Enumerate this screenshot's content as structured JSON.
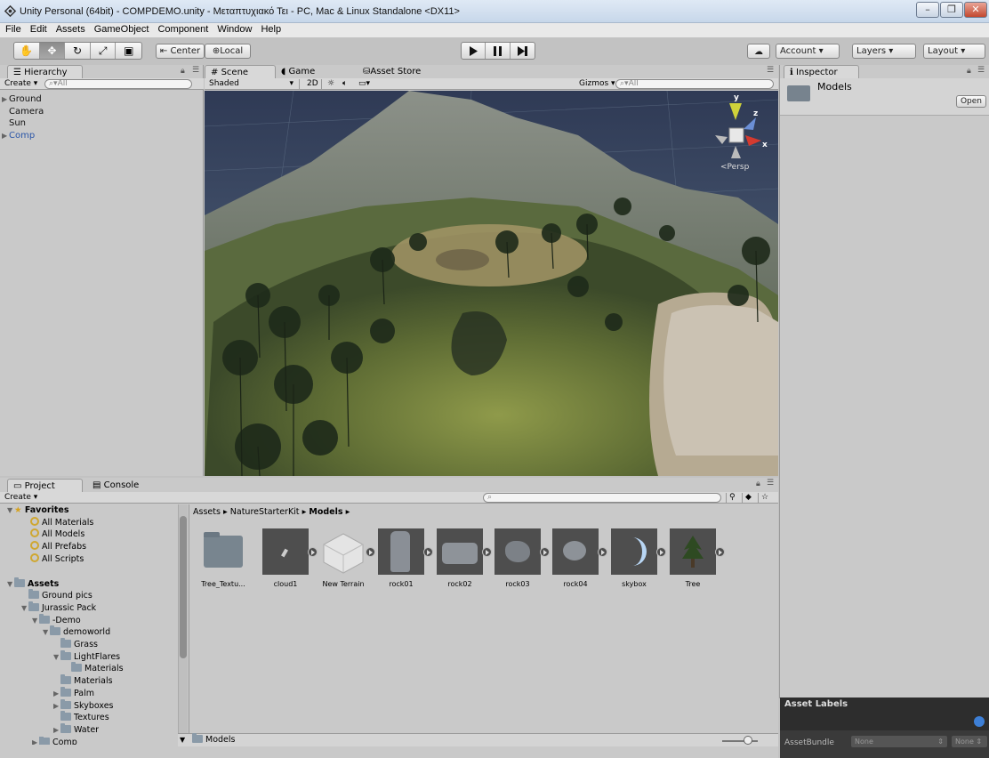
{
  "window": {
    "title": "Unity Personal (64bit) - COMPDEMO.unity - Μεταπτυχιακό Τει - PC, Mac & Linux Standalone <DX11>",
    "min_label": "–",
    "max_label": "❐",
    "close_label": "✕"
  },
  "menu": [
    "File",
    "Edit",
    "Assets",
    "GameObject",
    "Component",
    "Window",
    "Help"
  ],
  "toolbar": {
    "pivot_label": "Center",
    "space_label": "Local",
    "account_label": "Account",
    "layers_label": "Layers",
    "layout_label": "Layout"
  },
  "hierarchy": {
    "tab_label": "Hierarchy",
    "create_label": "Create",
    "search_placeholder": "All",
    "items": [
      "Ground",
      "Camera",
      "Sun",
      "Comp"
    ]
  },
  "scene": {
    "tabs": [
      "Scene",
      "Game",
      "Asset Store"
    ],
    "shading_label": "Shaded",
    "mode_2d_label": "2D",
    "gizmos_label": "Gizmos",
    "search_placeholder": "All",
    "gizmo_y": "y",
    "gizmo_z": "z",
    "gizmo_x": "x",
    "persp_label": "Persp"
  },
  "inspector": {
    "tab_label": "Inspector",
    "object_name": "Models",
    "open_label": "Open",
    "asset_labels_title": "Asset Labels",
    "assetbundle_label": "AssetBundle",
    "assetbundle_value": "None",
    "assetbundle_variant": "None"
  },
  "project": {
    "tab_project": "Project",
    "tab_console": "Console",
    "create_label": "Create",
    "favorites_label": "Favorites",
    "favorites": [
      "All Materials",
      "All Models",
      "All Prefabs",
      "All Scripts"
    ],
    "assets_label": "Assets",
    "tree": [
      "Ground pics",
      "Jurassic Pack",
      "-Demo",
      "demoworld",
      "Grass",
      "LightFlares",
      "Materials",
      "Materials",
      "Palm",
      "Skyboxes",
      "Textures",
      "Water",
      "Comp"
    ],
    "breadcrumb": [
      "Assets",
      "NatureStarterKit",
      "Models"
    ],
    "files": [
      "Tree_Textu...",
      "cloud1",
      "New Terrain",
      "rock01",
      "rock02",
      "rock03",
      "rock04",
      "skybox",
      "Tree"
    ],
    "footer_path": "Models"
  }
}
